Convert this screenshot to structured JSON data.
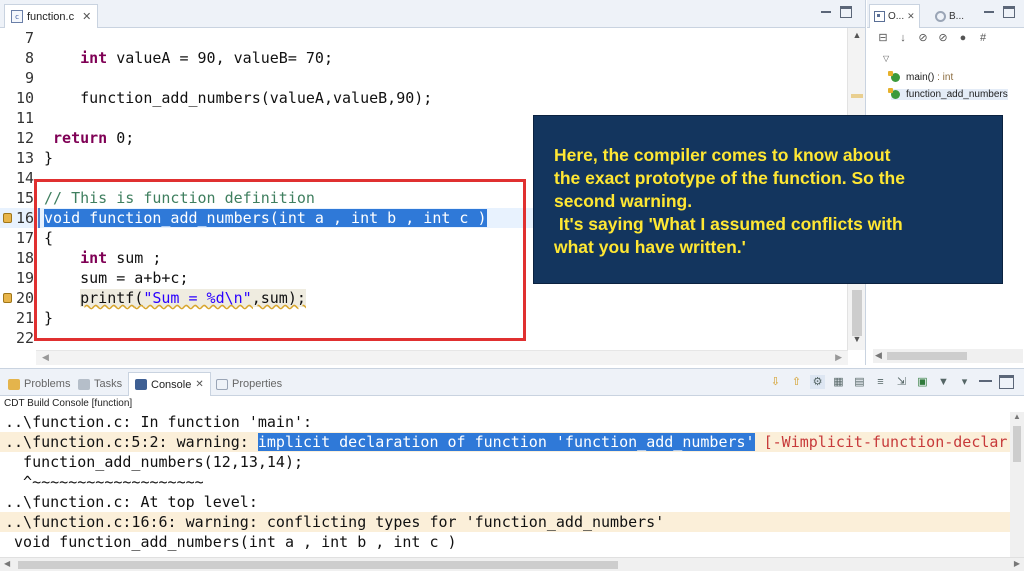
{
  "editor": {
    "tab_label": "function.c",
    "file_icon_text": "c",
    "lines": [
      {
        "n": "7",
        "segments": []
      },
      {
        "n": "8",
        "segments": [
          {
            "t": "    "
          },
          {
            "t": "int",
            "c": "kw"
          },
          {
            "t": " valueA = 90, valueB= 70;"
          }
        ]
      },
      {
        "n": "9",
        "segments": []
      },
      {
        "n": "10",
        "segments": [
          {
            "t": "    function_add_numbers(valueA,valueB,90);"
          }
        ]
      },
      {
        "n": "11",
        "segments": []
      },
      {
        "n": "12",
        "segments": [
          {
            "t": " "
          },
          {
            "t": "return",
            "c": "kw"
          },
          {
            "t": " 0;"
          }
        ]
      },
      {
        "n": "13",
        "segments": [
          {
            "t": "}"
          }
        ]
      },
      {
        "n": "14",
        "segments": []
      },
      {
        "n": "15",
        "segments": [
          {
            "t": "// This is function definition",
            "c": "cm"
          }
        ]
      },
      {
        "n": "16",
        "segments": [
          {
            "t": "void function_add_numbers(int a , int b , int c )",
            "c": "hl-sel"
          }
        ],
        "annot": true
      },
      {
        "n": "17",
        "segments": [
          {
            "t": "{"
          }
        ]
      },
      {
        "n": "18",
        "segments": [
          {
            "t": "    "
          },
          {
            "t": "int",
            "c": "kw"
          },
          {
            "t": " sum ;"
          }
        ]
      },
      {
        "n": "19",
        "segments": [
          {
            "t": "    sum = a+b+c;"
          }
        ]
      },
      {
        "n": "20",
        "segments": [
          {
            "t": "    "
          },
          {
            "t": "printf",
            "c": "warn-ul"
          },
          {
            "t": "(",
            "c": "warn-ul"
          },
          {
            "t": "\"Sum = %d\\n\"",
            "c": "st warn-ul"
          },
          {
            "t": ",sum);",
            "c": "warn-ul"
          }
        ],
        "annot": true
      },
      {
        "n": "21",
        "segments": [
          {
            "t": "}"
          }
        ]
      },
      {
        "n": "22",
        "segments": []
      }
    ]
  },
  "outline": {
    "tab_outline": "O...",
    "tab_build": "B...",
    "items": [
      {
        "label": "main()",
        "sub": " : int"
      },
      {
        "label": "function_add_numbers",
        "sub": ""
      }
    ]
  },
  "console": {
    "tabs": {
      "problems": "Problems",
      "tasks": "Tasks",
      "console": "Console",
      "properties": "Properties"
    },
    "subtitle": "CDT Build Console [function]",
    "lines": [
      {
        "warn": false,
        "segments": [
          {
            "t": "..\\function.c: In function 'main':"
          }
        ]
      },
      {
        "warn": true,
        "segments": [
          {
            "t": "..\\function.c:5:2: warning: "
          },
          {
            "t": "implicit declaration of function 'function_add_numbers'",
            "c": "sel"
          },
          {
            "t": " "
          },
          {
            "t": "[-Wimplicit-function-declar",
            "c": "flag"
          }
        ]
      },
      {
        "warn": false,
        "segments": [
          {
            "t": "  function_add_numbers(12,13,14);"
          }
        ]
      },
      {
        "warn": false,
        "segments": [
          {
            "t": "  ^~~~~~~~~~~~~~~~~~~~"
          }
        ]
      },
      {
        "warn": false,
        "segments": [
          {
            "t": "..\\function.c: At top level:"
          }
        ]
      },
      {
        "warn": true,
        "segments": [
          {
            "t": "..\\function.c:16:6: warning: conflicting types for 'function_add_numbers'"
          }
        ]
      },
      {
        "warn": false,
        "segments": [
          {
            "t": " void function_add_numbers(int a , int b , int c )"
          }
        ]
      }
    ]
  },
  "callout": {
    "lines": [
      "Here, the compiler comes to know about",
      "the exact prototype of the function. So the",
      "second warning.",
      " It's saying 'What I assumed conflicts with",
      "what you have written.'"
    ]
  },
  "colors": {
    "callout_bg": "#13355e",
    "callout_text": "#ffe733",
    "highlight_box": "#e03030",
    "selection": "#2f79d8"
  }
}
